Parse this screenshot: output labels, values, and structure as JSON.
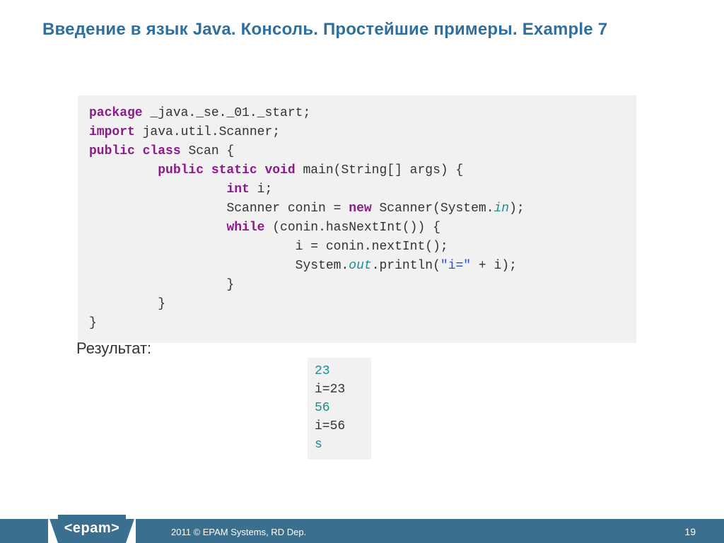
{
  "title": "Введение в язык Java. Консоль. Простейшие примеры. Example 7",
  "code": {
    "pkg_kw": "package",
    "pkg_rest": " _java._se._01._start;",
    "imp_kw": "import",
    "imp_rest": " java.util.Scanner;",
    "class_kw": "public class ",
    "class_rest": "Scan {",
    "main_indent": "         ",
    "main_kw": "public static void ",
    "main_rest": "main(String[] args) {",
    "l_int_indent": "                  ",
    "l_int_kw": "int",
    "l_int_rest": " i;",
    "l_scanner_indent": "                  ",
    "l_scanner_a": "Scanner conin = ",
    "l_new_kw": "new",
    "l_scanner_b": " Scanner(System.",
    "l_in_fld": "in",
    "l_scanner_c": ");",
    "l_while_indent": "                  ",
    "l_while_kw": "while",
    "l_while_rest": " (conin.hasNextInt()) {",
    "l_assign": "                           i = conin.nextInt();",
    "l_print_indent": "                           ",
    "l_print_a": "System.",
    "l_out_fld": "out",
    "l_print_b": ".println(",
    "l_print_str": "\"i=\"",
    "l_print_c": " + i);",
    "l_close1": "                  }",
    "l_close2": "         }",
    "l_close3": "}"
  },
  "result_label": "Результат:",
  "output": {
    "l1": "23",
    "l2": "i=23",
    "l3": "56",
    "l4": "i=56",
    "l5": "s"
  },
  "footer": {
    "logo": "<epam>",
    "copyright": "2011 © EPAM Systems, RD Dep.",
    "page": "19"
  }
}
